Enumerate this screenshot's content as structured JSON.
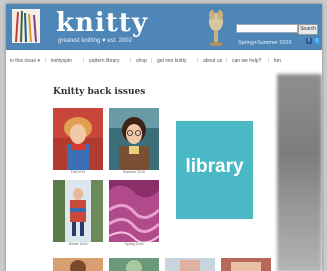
{
  "header": {
    "title": "knitty",
    "tagline": "greatest knitting ♥ est. 2002",
    "search_button": "Search",
    "issue": "Spring+Summer 2016",
    "colors": {
      "header_bg": "#4f86b8",
      "library_bg": "#4bb8c6"
    }
  },
  "nav": {
    "items": [
      {
        "label": "in this issue ▾"
      },
      {
        "label": "knittyspin"
      },
      {
        "label": "pattern library"
      },
      {
        "label": "shop"
      },
      {
        "label": "get into knitty"
      },
      {
        "label": "about us"
      },
      {
        "label": "can we help?"
      },
      {
        "label": "fun"
      }
    ]
  },
  "main": {
    "title": "Knitty back issues",
    "covers": [
      {
        "caption": "Fall 2019"
      },
      {
        "caption": "Summer 2019"
      },
      {
        "caption": "Winter 2019"
      },
      {
        "caption": "Spring 2018"
      }
    ],
    "library_label": "library"
  }
}
